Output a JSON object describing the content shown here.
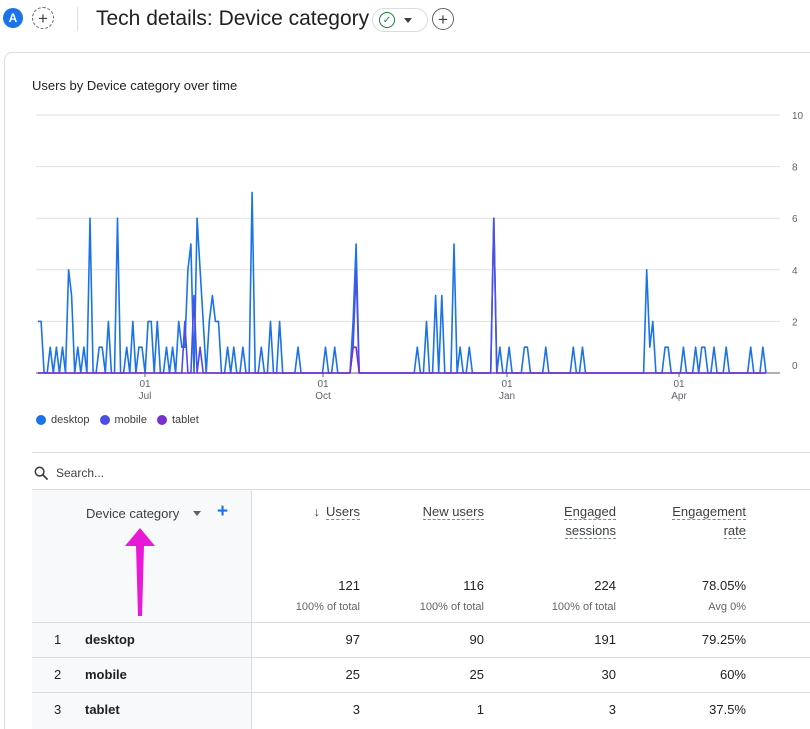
{
  "header": {
    "avatar_letter": "A",
    "title": "Tech details: Device category",
    "add_compare_icon": "plus-circle-dashed-icon",
    "status_icon": "check-circle-icon",
    "add_report_icon": "plus-circle-icon"
  },
  "chart": {
    "title": "Users by Device category over time"
  },
  "chart_data": {
    "type": "line",
    "title": "Users by Device category over time",
    "y_ticks": [
      "0",
      "2",
      "4",
      "6",
      "8",
      "10"
    ],
    "ylim": [
      0,
      10
    ],
    "x_ticks": [
      {
        "day": "01",
        "month": "Jul"
      },
      {
        "day": "01",
        "month": "Oct"
      },
      {
        "day": "01",
        "month": "Jan"
      },
      {
        "day": "01",
        "month": "Apr"
      }
    ],
    "grid": true,
    "legend_position": "bottom-left",
    "series": [
      {
        "name": "desktop",
        "color": "#1a73e8",
        "points": [
          [
            0,
            2
          ],
          [
            1,
            2
          ],
          [
            2,
            0
          ],
          [
            3,
            0
          ],
          [
            4,
            1
          ],
          [
            5,
            0
          ],
          [
            6,
            1
          ],
          [
            7,
            0
          ],
          [
            8,
            1
          ],
          [
            9,
            0
          ],
          [
            10,
            4
          ],
          [
            11,
            3
          ],
          [
            12,
            0
          ],
          [
            13,
            1
          ],
          [
            14,
            0
          ],
          [
            15,
            1
          ],
          [
            16,
            0
          ],
          [
            17,
            6
          ],
          [
            18,
            0
          ],
          [
            19,
            0
          ],
          [
            20,
            1
          ],
          [
            21,
            1
          ],
          [
            22,
            0
          ],
          [
            23,
            2
          ],
          [
            24,
            0
          ],
          [
            25,
            0
          ],
          [
            26,
            6
          ],
          [
            27,
            0
          ],
          [
            28,
            0
          ],
          [
            29,
            1
          ],
          [
            30,
            0
          ],
          [
            31,
            2
          ],
          [
            32,
            0
          ],
          [
            33,
            1
          ],
          [
            34,
            1
          ],
          [
            35,
            0
          ],
          [
            36,
            2
          ],
          [
            37,
            2
          ],
          [
            38,
            0
          ],
          [
            39,
            2
          ],
          [
            40,
            0
          ],
          [
            41,
            0
          ],
          [
            42,
            1
          ],
          [
            43,
            0
          ],
          [
            44,
            1
          ],
          [
            45,
            0
          ],
          [
            46,
            2
          ],
          [
            47,
            1
          ],
          [
            48,
            1
          ],
          [
            49,
            4
          ],
          [
            50,
            5
          ],
          [
            51,
            0
          ],
          [
            52,
            6
          ],
          [
            53,
            4
          ],
          [
            54,
            2
          ],
          [
            55,
            0
          ],
          [
            56,
            2
          ],
          [
            57,
            3
          ],
          [
            58,
            2
          ],
          [
            59,
            2
          ],
          [
            60,
            0
          ],
          [
            61,
            0
          ],
          [
            62,
            1
          ],
          [
            63,
            0
          ],
          [
            64,
            1
          ],
          [
            65,
            0
          ],
          [
            66,
            0
          ],
          [
            67,
            1
          ],
          [
            68,
            0
          ],
          [
            69,
            0
          ],
          [
            70,
            7
          ],
          [
            71,
            0
          ],
          [
            72,
            0
          ],
          [
            73,
            1
          ],
          [
            74,
            0
          ],
          [
            75,
            0
          ],
          [
            76,
            2
          ],
          [
            77,
            0
          ],
          [
            78,
            0
          ],
          [
            79,
            2
          ],
          [
            80,
            0
          ],
          [
            81,
            0
          ],
          [
            82,
            0
          ],
          [
            83,
            0
          ],
          [
            84,
            0
          ],
          [
            85,
            1
          ],
          [
            86,
            0
          ],
          [
            87,
            0
          ],
          [
            88,
            0
          ],
          [
            89,
            0
          ],
          [
            90,
            0
          ],
          [
            91,
            0
          ],
          [
            92,
            0
          ],
          [
            93,
            0
          ],
          [
            94,
            1
          ],
          [
            95,
            0
          ],
          [
            96,
            0
          ],
          [
            97,
            1
          ],
          [
            98,
            0
          ],
          [
            99,
            0
          ],
          [
            100,
            0
          ],
          [
            101,
            0
          ],
          [
            102,
            0
          ],
          [
            103,
            2
          ],
          [
            104,
            5
          ],
          [
            105,
            0
          ],
          [
            106,
            0
          ],
          [
            107,
            0
          ],
          [
            108,
            0
          ],
          [
            109,
            0
          ],
          [
            110,
            0
          ],
          [
            111,
            0
          ],
          [
            112,
            0
          ],
          [
            113,
            0
          ],
          [
            114,
            0
          ],
          [
            115,
            0
          ],
          [
            116,
            0
          ],
          [
            117,
            0
          ],
          [
            118,
            0
          ],
          [
            119,
            0
          ],
          [
            120,
            0
          ],
          [
            121,
            0
          ],
          [
            122,
            0
          ],
          [
            123,
            0
          ],
          [
            124,
            1
          ],
          [
            125,
            0
          ],
          [
            126,
            0
          ],
          [
            127,
            2
          ],
          [
            128,
            0
          ],
          [
            129,
            0
          ],
          [
            130,
            3
          ],
          [
            131,
            0
          ],
          [
            132,
            3
          ],
          [
            133,
            0
          ],
          [
            134,
            0
          ],
          [
            135,
            0
          ],
          [
            136,
            5
          ],
          [
            137,
            0
          ],
          [
            138,
            1
          ],
          [
            139,
            0
          ],
          [
            140,
            0
          ],
          [
            141,
            1
          ],
          [
            142,
            0
          ],
          [
            143,
            0
          ],
          [
            144,
            0
          ],
          [
            145,
            0
          ],
          [
            146,
            0
          ],
          [
            147,
            0
          ],
          [
            148,
            0
          ],
          [
            149,
            6
          ],
          [
            150,
            0
          ],
          [
            151,
            1
          ],
          [
            152,
            0
          ],
          [
            153,
            0
          ],
          [
            154,
            1
          ],
          [
            155,
            0
          ],
          [
            156,
            0
          ],
          [
            157,
            0
          ],
          [
            158,
            0
          ],
          [
            159,
            1
          ],
          [
            160,
            1
          ],
          [
            161,
            0
          ],
          [
            162,
            0
          ],
          [
            163,
            0
          ],
          [
            164,
            0
          ],
          [
            165,
            0
          ],
          [
            166,
            1
          ],
          [
            167,
            0
          ],
          [
            168,
            0
          ],
          [
            169,
            0
          ],
          [
            170,
            0
          ],
          [
            171,
            0
          ],
          [
            172,
            0
          ],
          [
            173,
            0
          ],
          [
            174,
            0
          ],
          [
            175,
            1
          ],
          [
            176,
            0
          ],
          [
            177,
            0
          ],
          [
            178,
            1
          ],
          [
            179,
            0
          ],
          [
            180,
            0
          ],
          [
            181,
            0
          ],
          [
            182,
            0
          ],
          [
            183,
            0
          ],
          [
            184,
            0
          ],
          [
            185,
            0
          ],
          [
            186,
            0
          ],
          [
            187,
            0
          ],
          [
            188,
            0
          ],
          [
            189,
            0
          ],
          [
            190,
            0
          ],
          [
            191,
            0
          ],
          [
            192,
            0
          ],
          [
            193,
            0
          ],
          [
            194,
            0
          ],
          [
            195,
            0
          ],
          [
            196,
            0
          ],
          [
            197,
            0
          ],
          [
            198,
            0
          ],
          [
            199,
            4
          ],
          [
            200,
            1
          ],
          [
            201,
            2
          ],
          [
            202,
            0
          ],
          [
            203,
            0
          ],
          [
            204,
            0
          ],
          [
            205,
            1
          ],
          [
            206,
            1
          ],
          [
            207,
            0
          ],
          [
            208,
            0
          ],
          [
            209,
            0
          ],
          [
            210,
            0
          ],
          [
            211,
            1
          ],
          [
            212,
            0
          ],
          [
            213,
            0
          ],
          [
            214,
            0
          ],
          [
            215,
            1
          ],
          [
            216,
            0
          ],
          [
            217,
            1
          ],
          [
            218,
            1
          ],
          [
            219,
            0
          ],
          [
            220,
            0
          ],
          [
            221,
            1
          ],
          [
            222,
            0
          ],
          [
            223,
            0
          ],
          [
            224,
            0
          ],
          [
            225,
            1
          ],
          [
            226,
            0
          ],
          [
            227,
            0
          ],
          [
            228,
            0
          ],
          [
            229,
            0
          ],
          [
            230,
            0
          ],
          [
            231,
            0
          ],
          [
            232,
            0
          ],
          [
            233,
            1
          ],
          [
            234,
            0
          ],
          [
            235,
            0
          ],
          [
            236,
            0
          ],
          [
            237,
            1
          ],
          [
            238,
            0
          ]
        ]
      },
      {
        "name": "mobile",
        "color": "#4c4ee8",
        "points": [
          [
            0,
            0
          ],
          [
            47,
            0
          ],
          [
            48,
            2
          ],
          [
            49,
            0
          ],
          [
            50,
            0
          ],
          [
            51,
            3
          ],
          [
            52,
            0
          ],
          [
            53,
            1
          ],
          [
            54,
            0
          ],
          [
            102,
            0
          ],
          [
            103,
            1
          ],
          [
            104,
            4
          ],
          [
            105,
            0
          ],
          [
            148,
            0
          ],
          [
            149,
            6
          ],
          [
            150,
            0
          ],
          [
            238,
            0
          ]
        ]
      },
      {
        "name": "tablet",
        "color": "#7b2fcf",
        "points": [
          [
            0,
            0
          ],
          [
            102,
            0
          ],
          [
            103,
            1
          ],
          [
            104,
            1
          ],
          [
            105,
            0
          ],
          [
            238,
            0
          ]
        ]
      }
    ]
  },
  "legend": [
    {
      "name": "desktop",
      "color": "#1a73e8"
    },
    {
      "name": "mobile",
      "color": "#4c4ee8"
    },
    {
      "name": "tablet",
      "color": "#7b2fcf"
    }
  ],
  "search": {
    "placeholder": "Search...",
    "icon": "search-icon"
  },
  "table": {
    "dimension_label": "Device category",
    "columns": [
      {
        "label_line1": "Users",
        "label_line2": "",
        "sorted_desc": true,
        "total": "121",
        "total_sub": "100% of total"
      },
      {
        "label_line1": "New users",
        "label_line2": "",
        "sorted_desc": false,
        "total": "116",
        "total_sub": "100% of total"
      },
      {
        "label_line1": "Engaged",
        "label_line2": "sessions",
        "sorted_desc": false,
        "total": "224",
        "total_sub": "100% of total"
      },
      {
        "label_line1": "Engagement",
        "label_line2": "rate",
        "sorted_desc": false,
        "total": "78.05%",
        "total_sub": "Avg 0%"
      }
    ],
    "rows": [
      {
        "idx": "1",
        "name": "desktop",
        "values": [
          "97",
          "90",
          "191",
          "79.25%"
        ]
      },
      {
        "idx": "2",
        "name": "mobile",
        "values": [
          "25",
          "25",
          "30",
          "60%"
        ]
      },
      {
        "idx": "3",
        "name": "tablet",
        "values": [
          "3",
          "1",
          "3",
          "37.5%"
        ]
      }
    ]
  },
  "annotation": {
    "arrow_color": "#e81ad6"
  }
}
